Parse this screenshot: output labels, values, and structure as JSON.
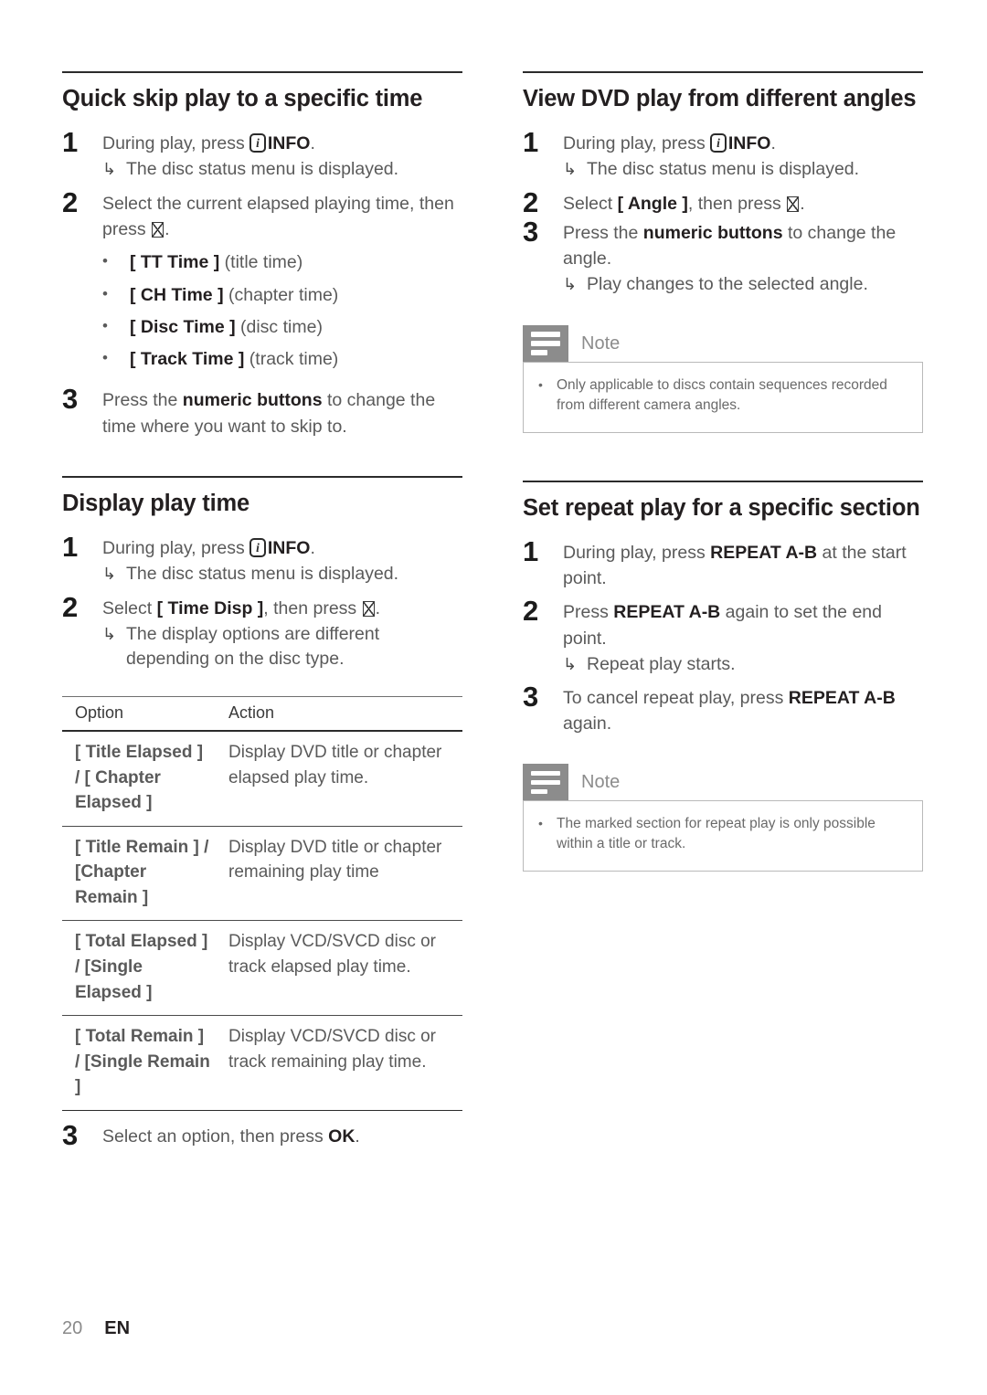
{
  "page": {
    "number": "20",
    "language": "EN"
  },
  "icons": {
    "info_key": "i",
    "note_label": "Note"
  },
  "left_column": {
    "section1": {
      "heading": "Quick skip play to a specific time",
      "steps": [
        {
          "num": "1",
          "text_before": "During play, press ",
          "key": "INFO",
          "text_after": ".",
          "result": "The disc status menu is displayed."
        },
        {
          "num": "2",
          "text": "Select the current elapsed playing time, then press",
          "text_tail": ".",
          "bullets": [
            {
              "option": "[ TT Time ]",
              "desc": "(title time)"
            },
            {
              "option": "[ CH Time ]",
              "desc": "(chapter time)"
            },
            {
              "option": "[ Disc Time ]",
              "desc": "(disc time)"
            },
            {
              "option": "[ Track Time ]",
              "desc": "(track time)"
            }
          ]
        },
        {
          "num": "3",
          "text_before": "Press the ",
          "bold": "numeric buttons",
          "text_after": " to change the time where you want to skip to."
        }
      ]
    },
    "section2": {
      "heading": "Display play time",
      "steps": [
        {
          "num": "1",
          "text_before": "During play, press ",
          "key": "INFO",
          "text_after": ".",
          "result": "The disc status menu is displayed."
        },
        {
          "num": "2",
          "text_before": "Select ",
          "bold": "[ Time Disp ]",
          "text_after": ", then press",
          "text_tail": ".",
          "result": "The display options are different depending on the disc type."
        }
      ],
      "table": {
        "headers": [
          "Option",
          "Action"
        ],
        "rows": [
          {
            "option": "[ Title Elapsed ] / [ Chapter Elapsed ]",
            "action": "Display DVD title or chapter elapsed play time."
          },
          {
            "option": "[ Title Remain ] / [Chapter Remain ]",
            "action": "Display DVD title or chapter remaining play time"
          },
          {
            "option": "[ Total Elapsed ] / [Single Elapsed ]",
            "action": "Display VCD/SVCD disc or track elapsed play time."
          },
          {
            "option": "[ Total Remain ] / [Single Remain ]",
            "action": "Display VCD/SVCD disc or track remaining play time."
          }
        ]
      },
      "final_step": {
        "num": "3",
        "text_before": "Select an option, then press ",
        "bold": "OK",
        "text_after": "."
      }
    }
  },
  "right_column": {
    "section1": {
      "heading": "View DVD play from different angles",
      "steps": [
        {
          "num": "1",
          "text_before": "During play, press ",
          "key": "INFO",
          "text_after": ".",
          "result": "The disc status menu is displayed."
        },
        {
          "num": "2",
          "text_before": "Select ",
          "bold": "[ Angle ]",
          "text_after": ", then press",
          "text_tail": "."
        },
        {
          "num": "3",
          "text_before": "Press the ",
          "bold": "numeric buttons",
          "text_after": " to change the angle.",
          "result": "Play changes to the selected angle."
        }
      ],
      "note": {
        "label": "Note",
        "items": [
          "Only applicable to discs contain sequences recorded from different camera angles."
        ]
      }
    },
    "section2": {
      "heading": "Set repeat play for a specific section",
      "steps": [
        {
          "num": "1",
          "text_before": "During play, press ",
          "bold": "REPEAT A-B",
          "text_after": " at the start point."
        },
        {
          "num": "2",
          "text_before": "Press ",
          "bold": "REPEAT A-B",
          "text_after": " again to set the end point.",
          "result": "Repeat play starts."
        },
        {
          "num": "3",
          "text_before": "To cancel repeat play, press ",
          "bold": "REPEAT A-B",
          "text_after": " again."
        }
      ],
      "note": {
        "label": "Note",
        "items": [
          "The marked section for repeat play is only possible within a title or track."
        ]
      }
    }
  }
}
